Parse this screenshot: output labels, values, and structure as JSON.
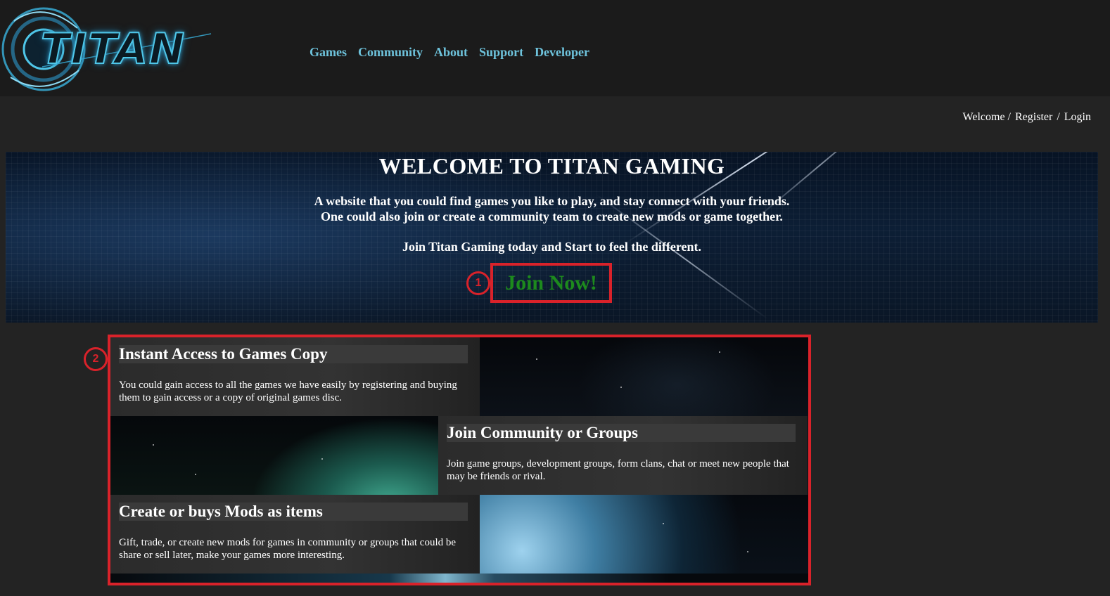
{
  "header": {
    "logo_text": "TITAN",
    "nav": [
      "Games",
      "Community",
      "About",
      "Support",
      "Developer"
    ],
    "user_links": {
      "welcome": "Welcome /",
      "register": "Register",
      "separator": "/",
      "login": "Login"
    }
  },
  "hero": {
    "title": "WELCOME TO TITAN GAMING",
    "desc_line1": "A website that you could find games you like to play, and stay connect with your friends.",
    "desc_line2": "One could also join or create a community team to create new mods or game together.",
    "cta_text": "Join Titan Gaming today and Start to feel the different.",
    "join_label": "Join Now!",
    "marker": "1"
  },
  "features": {
    "marker": "2",
    "items": [
      {
        "heading": "Instant Access to Games Copy",
        "desc": "You could gain access to all the games we have easily by registering and buying them to gain access or a copy of original games disc."
      },
      {
        "heading": "Join Community or Groups",
        "desc": "Join game groups, development groups, form clans, chat or meet new people that may be friends or rival."
      },
      {
        "heading": "Create or buys Mods as items",
        "desc": "Gift, trade, or create new mods for games in community or groups that could be share or sell later, make your games more interesting."
      }
    ]
  },
  "colors": {
    "nav": "#6ec3dc",
    "highlight": "#d9222a",
    "join": "#1d8a1d",
    "background": "#232323"
  }
}
